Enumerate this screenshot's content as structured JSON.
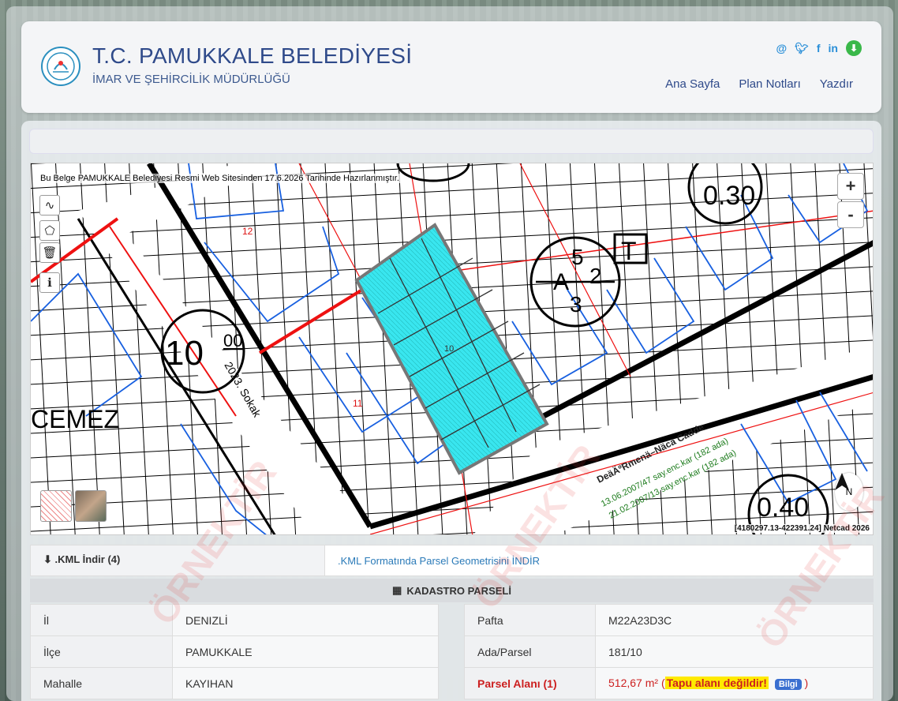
{
  "header": {
    "title": "T.C. PAMUKKALE BELEDİYESİ",
    "subtitle": "İMAR VE ŞEHİRCİLİK MÜDÜRLÜĞÜ",
    "social": [
      "@",
      "twitter-icon",
      "facebook-icon",
      "linkedin-icon",
      "download-icon"
    ],
    "nav": [
      "Ana Sayfa",
      "Plan Notları",
      "Yazdır"
    ]
  },
  "map": {
    "note": "Bu Belge PAMUKKALE Belediyesi Resmi Web Sitesinden 17.6.2026 Tarihinde Hazırlanmıştır.",
    "zoom_in": "+",
    "zoom_out": "-",
    "north": "N",
    "coords": "[4180297.13-422391.24] Netcad 2026",
    "labels": {
      "big_num": "10",
      "big_sup": "00",
      "road": "2023. Sokak",
      "cemez": "CEMEZ",
      "parcel_12": "12",
      "parcel_11": "11",
      "parcel_10": "10",
      "zone_a": "A",
      "zone_5": "5",
      "zone_2": "2",
      "zone_3": "3",
      "t_box": "T",
      "ratio_top": "0.30",
      "ratio_bottom": "0.40",
      "street": "DeäÄºRmenä–Näca Cadde",
      "note1": "13.06.2007/47 say.enc.kar (182 ada)",
      "note2": "21.02.2007/13 say.enc.kar (182 ada)"
    }
  },
  "kml": {
    "left": ".KML İndir (4)",
    "right": ".KML Formatında Parsel Geometrisini İNDİR"
  },
  "kadastro": {
    "heading": "KADASTRO PARSELİ",
    "left": [
      {
        "k": "İl",
        "v": "DENIZLİ"
      },
      {
        "k": "İlçe",
        "v": "PAMUKKALE"
      },
      {
        "k": "Mahalle",
        "v": "KAYIHAN"
      }
    ],
    "right": [
      {
        "k": "Pafta",
        "v": "M22A23D3C"
      },
      {
        "k": "Ada/Parsel",
        "v": "181/10"
      },
      {
        "k": "Parsel Alanı (1)",
        "v": "512,67 m²"
      }
    ],
    "tapu_note": "Tapu alanı değildir!",
    "bilgi": "Bilgi"
  },
  "watermark": "ÖRNEKTİR"
}
